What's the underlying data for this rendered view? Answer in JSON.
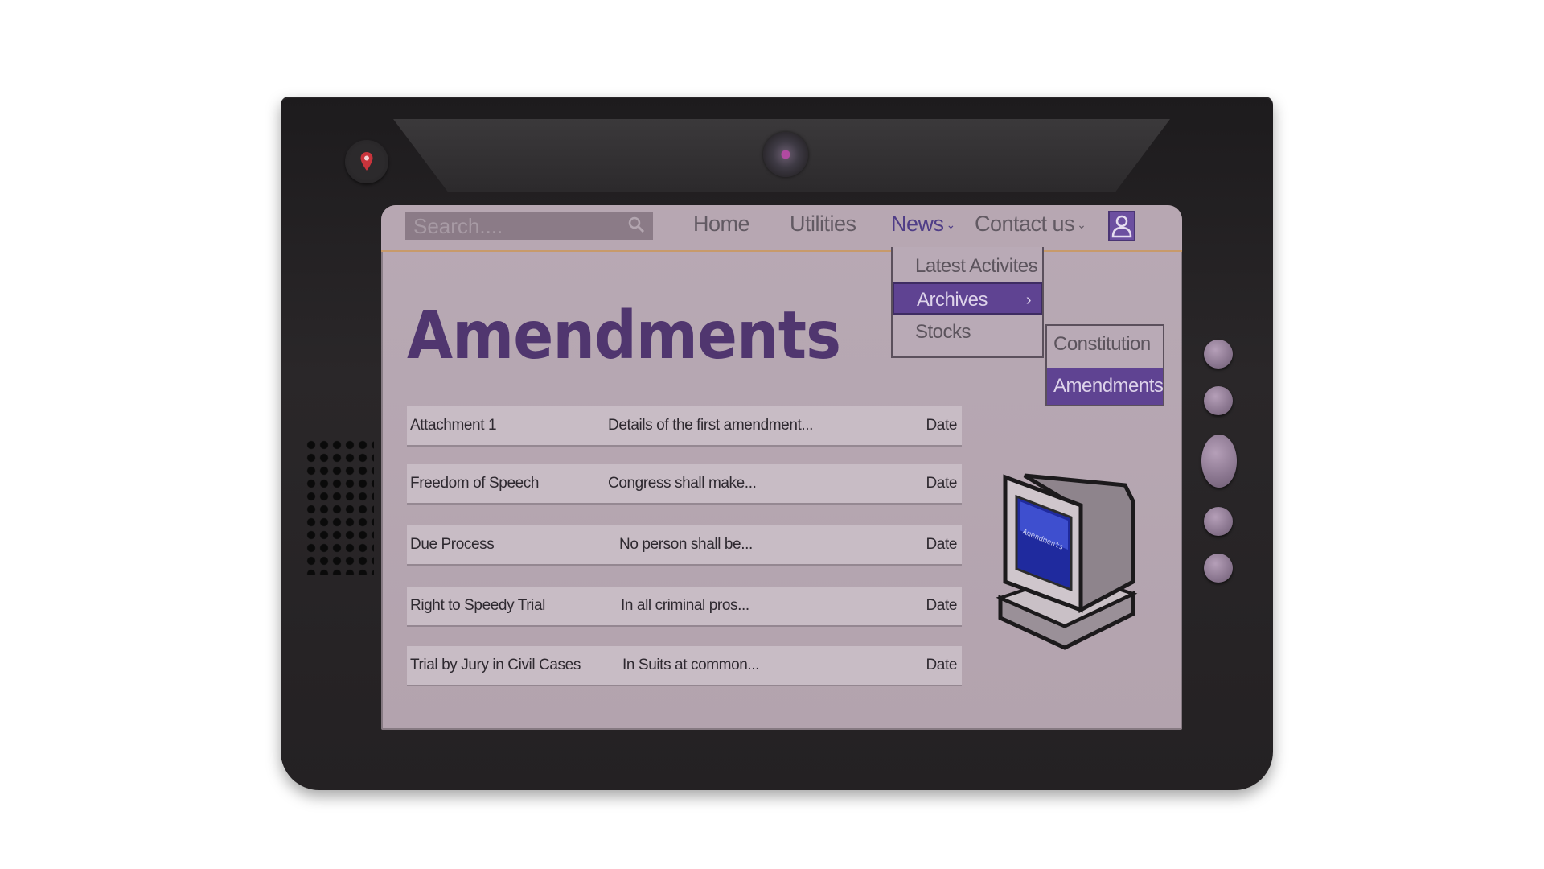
{
  "search": {
    "placeholder": "Search...."
  },
  "nav": {
    "home": "Home",
    "utilities": "Utilities",
    "news": "News",
    "contact": "Contact us"
  },
  "dropdown": {
    "items": [
      {
        "label": "Latest Activites",
        "arrow": "›"
      },
      {
        "label": "Archives",
        "arrow": "›"
      },
      {
        "label": "Stocks"
      }
    ]
  },
  "submenu": {
    "items": [
      {
        "label": "Constitution"
      },
      {
        "label": "Amendments"
      }
    ]
  },
  "page": {
    "title": "Amendments"
  },
  "table": {
    "rows": [
      {
        "title": "Attachment 1",
        "summary": "Details of the first amendment...",
        "date": "Date"
      },
      {
        "title": "Freedom of Speech",
        "summary": "Congress shall make...",
        "date": "Date"
      },
      {
        "title": "Due Process",
        "summary": "No person shall be...",
        "date": "Date"
      },
      {
        "title": "Right to Speedy Trial",
        "summary": "In all criminal pros...",
        "date": "Date"
      },
      {
        "title": "Trial by Jury in Civil Cases",
        "summary": "In Suits at common...",
        "date": "Date"
      }
    ]
  },
  "illustration": {
    "screen_label": "Amendments"
  },
  "colors": {
    "accent": "#5f4392",
    "title": "#50366f",
    "screen_bg": "#b8a9b4",
    "device": "#242123"
  },
  "icons": [
    "map-pin-icon",
    "search-icon",
    "chevron-down-icon",
    "chevron-right-icon",
    "user-icon",
    "retro-computer-icon"
  ]
}
